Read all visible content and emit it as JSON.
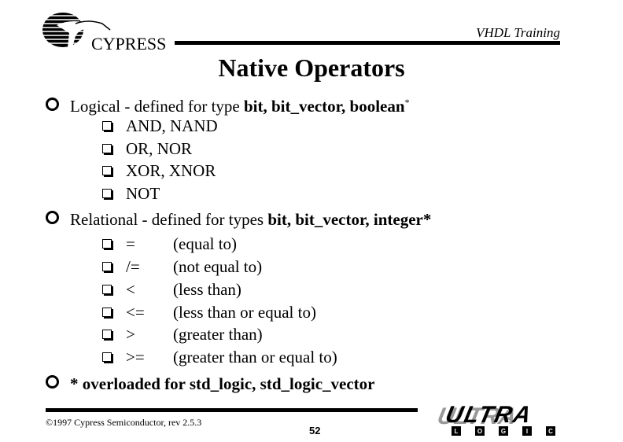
{
  "header": {
    "logo_text": "CYPRESS",
    "label": "VHDL Training"
  },
  "title": "Native Operators",
  "bullets": [
    {
      "prefix": "Logical - defined for type ",
      "bold": "bit, bit_vector, boolean",
      "suffix": "*",
      "items": [
        {
          "text": "AND, NAND"
        },
        {
          "text": "OR, NOR"
        },
        {
          "text": "XOR, XNOR"
        },
        {
          "text": "NOT"
        }
      ]
    },
    {
      "prefix": "Relational - defined for types ",
      "bold": "bit, bit_vector, integer*",
      "items": [
        {
          "op": "=",
          "desc": "(equal to)"
        },
        {
          "op": "/=",
          "desc": "(not equal to)"
        },
        {
          "op": "<",
          "desc": "(less than)"
        },
        {
          "op": "<=",
          "desc": "(less than or equal to)"
        },
        {
          "op": ">",
          "desc": "(greater than)"
        },
        {
          "op": ">=",
          "desc": "(greater than or equal to)"
        }
      ]
    },
    {
      "bold": "* overloaded for std_logic, std_logic_vector"
    }
  ],
  "footer": {
    "copyright": "©1997 Cypress Semiconductor, rev 2.5.3",
    "page_number": "52",
    "ultra_text": "ULTRA",
    "logic_letters": [
      "L",
      "O",
      "G",
      "I",
      "C"
    ]
  }
}
